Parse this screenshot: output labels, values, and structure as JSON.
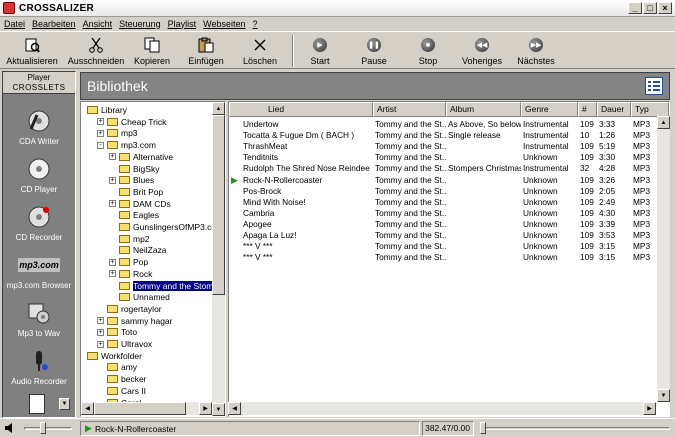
{
  "window": {
    "title": "CROSSALIZER",
    "buttons": [
      "_",
      "□",
      "×"
    ]
  },
  "menu": [
    "Datei",
    "Bearbeiten",
    "Ansicht",
    "Steuerung",
    "Playlist",
    "Webseiten",
    "?"
  ],
  "toolbar": [
    {
      "label": "Aktualisieren",
      "icon": "refresh-icon"
    },
    {
      "label": "Ausschneiden",
      "icon": "scissors-icon"
    },
    {
      "label": "Kopieren",
      "icon": "copy-icon"
    },
    {
      "label": "Einfügen",
      "icon": "paste-icon"
    },
    {
      "label": "Löschen",
      "icon": "delete-icon"
    },
    {
      "label": "Start",
      "icon": "play-icon",
      "glyph": "▶"
    },
    {
      "label": "Pause",
      "icon": "pause-icon",
      "glyph": "❚❚"
    },
    {
      "label": "Stop",
      "icon": "stop-icon",
      "glyph": "■"
    },
    {
      "label": "Voheriges",
      "icon": "previous-icon",
      "glyph": "◀◀"
    },
    {
      "label": "Nächstes",
      "icon": "next-icon",
      "glyph": "▶▶"
    }
  ],
  "sidebar": {
    "tab1": "Player",
    "tab2": "CROSSLETS",
    "items": [
      {
        "label": "CDA Writer",
        "icon": "cda-writer-icon"
      },
      {
        "label": "CD Player",
        "icon": "cd-player-icon"
      },
      {
        "label": "CD Recorder",
        "icon": "cd-recorder-icon"
      },
      {
        "label": "mp3.com Browser",
        "icon": "mp3com-browser-icon",
        "logo": "mp3.com"
      },
      {
        "label": "Mp3 to Wav",
        "icon": "mp3-to-wav-icon"
      },
      {
        "label": "Audio Recorder",
        "icon": "audio-recorder-icon"
      }
    ]
  },
  "library": {
    "title": "Bibliothek"
  },
  "tree": [
    {
      "label": "Library",
      "level": 0,
      "expander": ""
    },
    {
      "label": "Cheap Trick",
      "level": 1,
      "expander": "+"
    },
    {
      "label": "mp3",
      "level": 1,
      "expander": "+"
    },
    {
      "label": "mp3.com",
      "level": 1,
      "expander": "-"
    },
    {
      "label": "Alternative",
      "level": 2,
      "expander": "+"
    },
    {
      "label": "BigSky",
      "level": 2,
      "expander": ""
    },
    {
      "label": "Blues",
      "level": 2,
      "expander": "+"
    },
    {
      "label": "Brit Pop",
      "level": 2,
      "expander": ""
    },
    {
      "label": "DAM CDs",
      "level": 2,
      "expander": "+"
    },
    {
      "label": "Eagles",
      "level": 2,
      "expander": ""
    },
    {
      "label": "GunslingersOfMP3.com",
      "level": 2,
      "expander": ""
    },
    {
      "label": "mp2",
      "level": 2,
      "expander": ""
    },
    {
      "label": "NeilZaza",
      "level": 2,
      "expander": ""
    },
    {
      "label": "Pop",
      "level": 2,
      "expander": "+"
    },
    {
      "label": "Rock",
      "level": 2,
      "expander": "+"
    },
    {
      "label": "Tommy and the Stompers",
      "level": 2,
      "expander": "",
      "selected": true
    },
    {
      "label": "Unnamed",
      "level": 2,
      "expander": ""
    },
    {
      "label": "rogertaylor",
      "level": 1,
      "expander": ""
    },
    {
      "label": "sammy hagar",
      "level": 1,
      "expander": "+"
    },
    {
      "label": "Toto",
      "level": 1,
      "expander": "+"
    },
    {
      "label": "Ultravox",
      "level": 1,
      "expander": "+"
    },
    {
      "label": "Workfolder",
      "level": 0,
      "expander": ""
    },
    {
      "label": "amy",
      "level": 1,
      "expander": ""
    },
    {
      "label": "becker",
      "level": 1,
      "expander": ""
    },
    {
      "label": "Cars II",
      "level": 1,
      "expander": ""
    },
    {
      "label": "Carol",
      "level": 1,
      "expander": ""
    }
  ],
  "list": {
    "columns": [
      "Lied",
      "Artist",
      "Album",
      "Genre",
      "#",
      "Dauer",
      "Typ"
    ],
    "rows": [
      [
        "Undertow",
        "Tommy and the St...",
        "As Above, So below",
        "Instrumental",
        "109",
        "3:33",
        "MP3"
      ],
      [
        "Tocatta & Fugue Dm ( BACH )",
        "Tommy and the St...",
        "Single release",
        "Instrumental",
        "10",
        "1:26",
        "MP3"
      ],
      [
        "ThrashMeat",
        "Tommy and the St...",
        "",
        "Instrumental",
        "109",
        "5:19",
        "MP3"
      ],
      [
        "Tenditnits",
        "Tommy and the St...",
        "",
        "Unknown",
        "109",
        "3:30",
        "MP3"
      ],
      [
        "Rudolph The Shred Nose Reindee",
        "Tommy and the St...",
        "Stompers Christmas",
        "Instrumental",
        "32",
        "4:28",
        "MP3"
      ],
      [
        "Rock-N-Rollercoaster",
        "Tommy and the St...",
        "",
        "Unknown",
        "109",
        "3:26",
        "MP3"
      ],
      [
        "Pos-Brock",
        "Tommy and the St...",
        "",
        "Unknown",
        "109",
        "2:05",
        "MP3"
      ],
      [
        "Mind With Noise!",
        "Tommy and the St...",
        "",
        "Unknown",
        "109",
        "2:49",
        "MP3"
      ],
      [
        "Cambria",
        "Tommy and the St...",
        "",
        "Unknown",
        "109",
        "4:30",
        "MP3"
      ],
      [
        "Apogee",
        "Tommy and the St...",
        "",
        "Unknown",
        "109",
        "3:39",
        "MP3"
      ],
      [
        "Apaga La Luz!",
        "Tommy and the St...",
        "",
        "Unknown",
        "109",
        "3:53",
        "MP3"
      ],
      [
        "*** V ***",
        "Tommy and the St...",
        "",
        "Unknown",
        "109",
        "3:15",
        "MP3"
      ],
      [
        "*** V ***",
        "Tommy and the St...",
        "",
        "Unknown",
        "109",
        "3:15",
        "MP3"
      ]
    ],
    "playing_row": 5
  },
  "status": {
    "track": "Rock-N-Rollercoaster",
    "time": "382.47/0.00"
  }
}
